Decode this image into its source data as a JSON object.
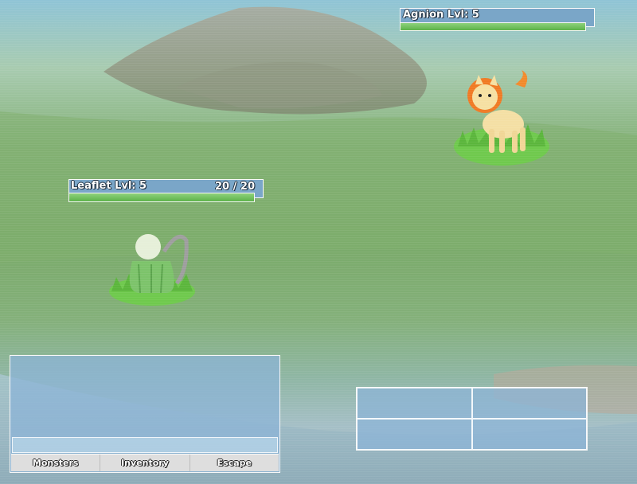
{
  "enemy": {
    "name": "Agnion",
    "level_text": "Lvl: 5",
    "hp_fraction": 1.0
  },
  "player": {
    "name": "Leaflet",
    "level_text": "Lvl: 5",
    "hp_current": "20",
    "hp_max": "20",
    "hp_separator": "/",
    "hp_fraction": 1.0
  },
  "menu": {
    "tabs": [
      {
        "label": "Monsters"
      },
      {
        "label": "Inventory"
      },
      {
        "label": "Escape"
      }
    ]
  },
  "message": {
    "text": ""
  },
  "actions": [
    {
      "label": ""
    },
    {
      "label": ""
    },
    {
      "label": ""
    },
    {
      "label": ""
    }
  ],
  "colors": {
    "hud_bar": "#7aa6c8",
    "hp_fill": "#5db24a",
    "panel": "#8cb4d7"
  }
}
